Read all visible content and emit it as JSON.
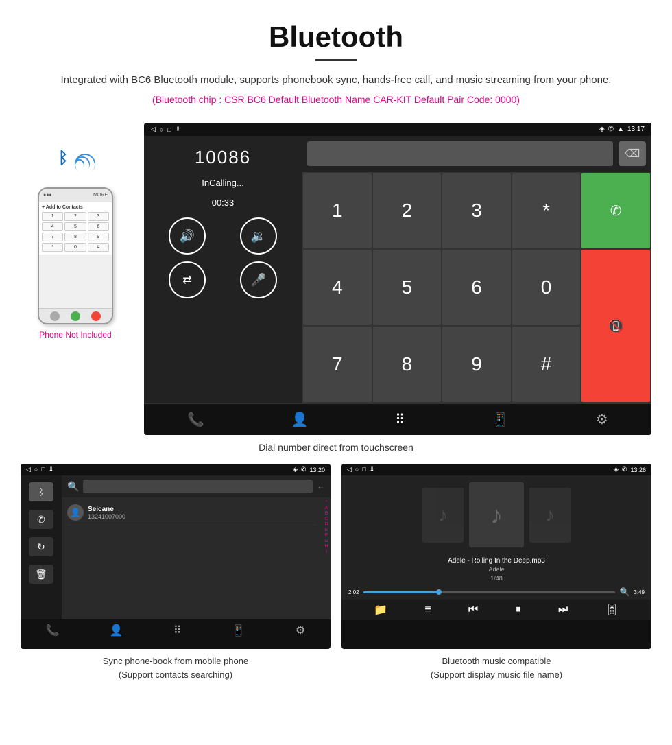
{
  "header": {
    "title": "Bluetooth",
    "description": "Integrated with BC6 Bluetooth module, supports phonebook sync, hands-free call, and music streaming from your phone.",
    "specs": "(Bluetooth chip : CSR BC6    Default Bluetooth Name CAR-KIT    Default Pair Code: 0000)"
  },
  "phone_section": {
    "phone_not_included": "Phone Not Included",
    "dial_number": "10086",
    "status": "InCalling...",
    "timer": "00:33",
    "status_bar_time": "13:17",
    "keys": [
      "1",
      "2",
      "3",
      "*",
      "4",
      "5",
      "6",
      "0",
      "7",
      "8",
      "9",
      "#"
    ],
    "caption": "Dial number direct from touchscreen"
  },
  "phonebook_screen": {
    "status_bar_time": "13:20",
    "contact_name": "Seicane",
    "contact_number": "13241007000",
    "alpha_strip": [
      "*",
      "A",
      "B",
      "C",
      "D",
      "E",
      "F",
      "G",
      "H",
      "I"
    ],
    "caption_line1": "Sync phone-book from mobile phone",
    "caption_line2": "(Support contacts searching)"
  },
  "music_screen": {
    "status_bar_time": "13:26",
    "track_title": "Adele - Rolling In the Deep.mp3",
    "artist": "Adele",
    "track_info": "1/48",
    "time_current": "2:02",
    "time_total": "3:49",
    "progress_pct": 30,
    "caption_line1": "Bluetooth music compatible",
    "caption_line2": "(Support display music file name)"
  },
  "icons": {
    "bluetooth": "ᛒ",
    "back": "◁",
    "circle": "○",
    "square": "□",
    "download": "⬇",
    "location": "◈",
    "phone": "✆",
    "signal": "▲",
    "wifi": "⊕",
    "volume_up": "🔊",
    "volume_down": "🔉",
    "transfer": "⇄",
    "mic": "🎤",
    "phone_transfer": "⇉",
    "contacts": "👤",
    "keypad": "⠿",
    "phone_manage": "📱",
    "gear": "⚙",
    "music_note": "♪",
    "shuffle": "⇌",
    "prev": "⏮",
    "play": "⏸",
    "next": "⏭",
    "equalizer": "🎚",
    "folder": "📁",
    "list": "≡",
    "search": "🔍",
    "trash": "🗑",
    "sync": "↻"
  }
}
